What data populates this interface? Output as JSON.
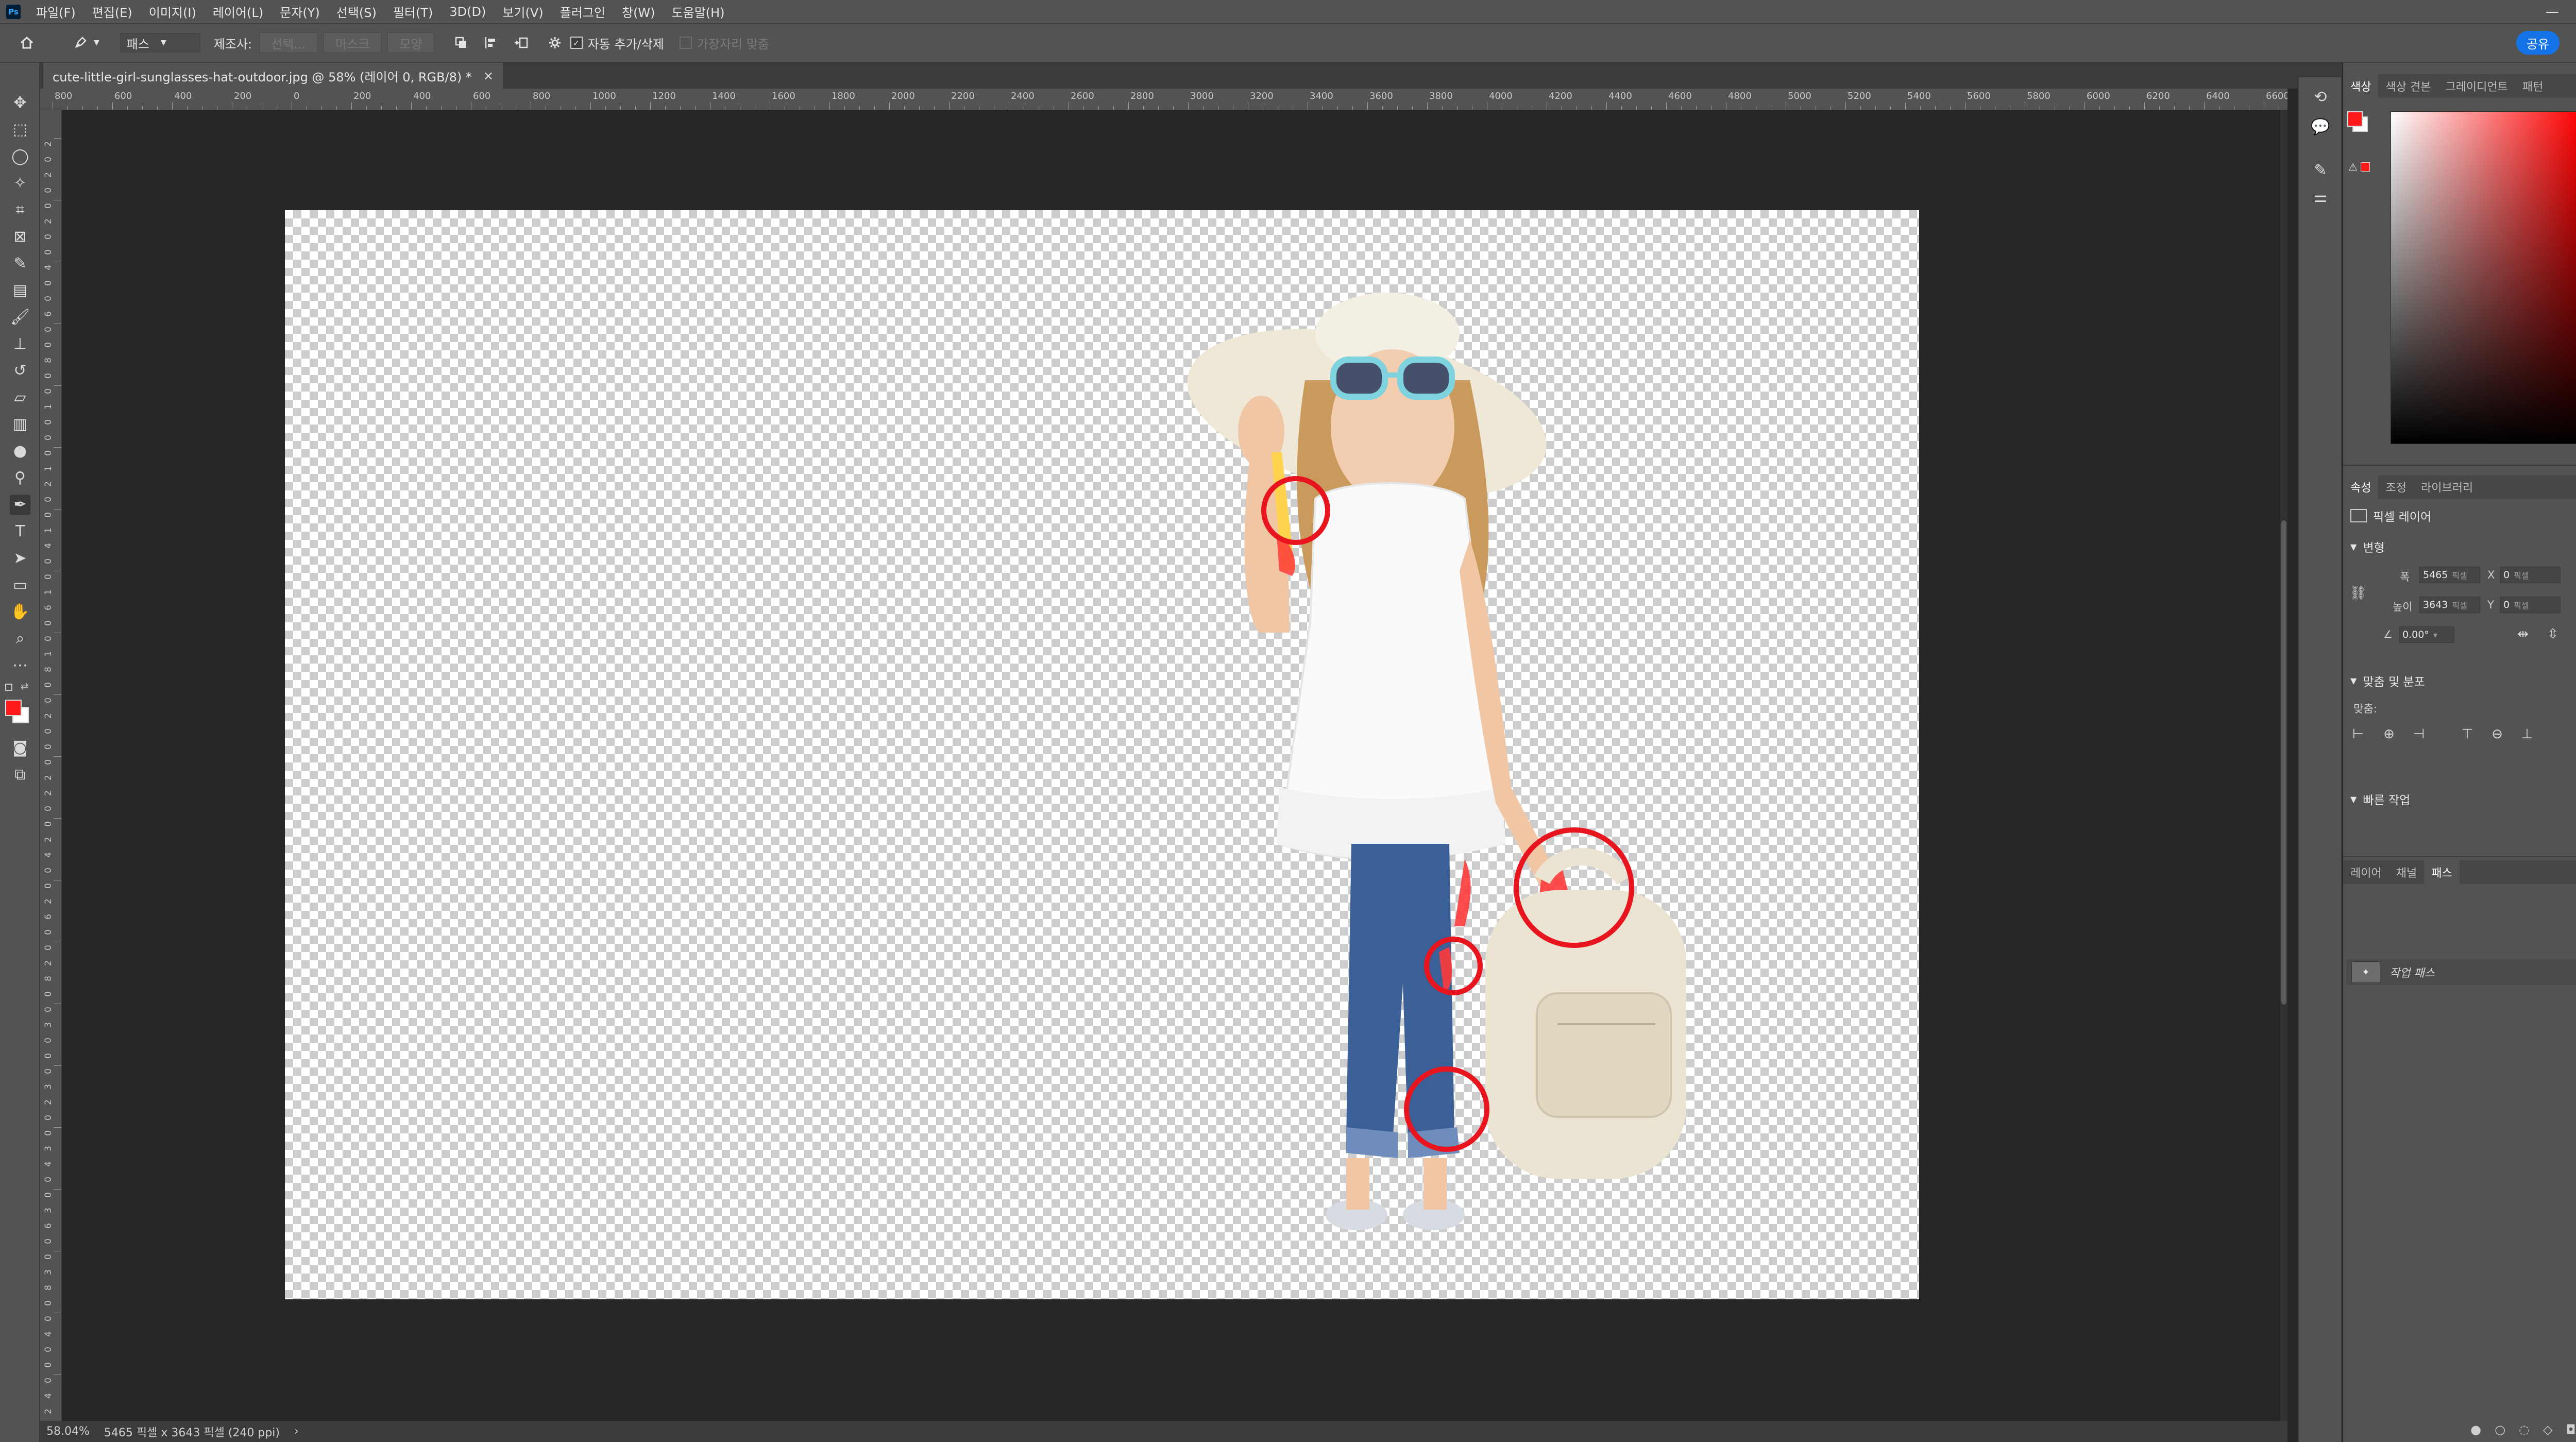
{
  "app": {
    "logo": "Ps",
    "menu": [
      "파일(F)",
      "편집(E)",
      "이미지(I)",
      "레이어(L)",
      "문자(Y)",
      "선택(S)",
      "필터(T)",
      "3D(D)",
      "보기(V)",
      "플러그인",
      "창(W)",
      "도움말(H)"
    ],
    "window_controls": [
      "—",
      "❐",
      "✕"
    ]
  },
  "options": {
    "mode": "패스",
    "make_label": "제조사:",
    "make_buttons": [
      "선택...",
      "마스크",
      "모양"
    ],
    "auto_add_delete_label": "자동 추가/삭제",
    "auto_add_delete_checked": true,
    "align_edges_label": "가장자리 맞춤",
    "align_edges_checked": false,
    "share_label": "공유"
  },
  "document": {
    "tab_title": "cute-little-girl-sunglasses-hat-outdoor.jpg @ 58% (레이어 0, RGB/8) *",
    "tab_close": "×",
    "ruler_top": [
      "800",
      "600",
      "400",
      "200",
      "0",
      "200",
      "400",
      "600",
      "800",
      "1000",
      "1200",
      "1400",
      "1600",
      "1800",
      "2000",
      "2200",
      "2400",
      "2600",
      "2800",
      "3000",
      "3200",
      "3400",
      "3600",
      "3800",
      "4000",
      "4200",
      "4400",
      "4600",
      "4800",
      "5000",
      "5200",
      "5400",
      "5600",
      "5800",
      "6000",
      "6200",
      "6400",
      "6600"
    ],
    "ruler_left": [
      "2",
      "0",
      "2",
      "0",
      "0",
      "2",
      "0",
      "0",
      "4",
      "0",
      "0",
      "6",
      "0",
      "0",
      "8",
      "0",
      "0",
      "1",
      "0",
      "0",
      "0",
      "1",
      "2",
      "0",
      "0",
      "1",
      "4",
      "0",
      "0",
      "1",
      "6",
      "0",
      "0",
      "1",
      "8",
      "0",
      "0",
      "2",
      "0",
      "0",
      "0",
      "2",
      "2",
      "0",
      "0",
      "2",
      "4",
      "0",
      "0",
      "2",
      "6",
      "0",
      "0",
      "2",
      "8",
      "0",
      "0",
      "3",
      "0",
      "0",
      "0",
      "3",
      "2",
      "0",
      "0",
      "3",
      "4",
      "0",
      "0",
      "3",
      "6",
      "0",
      "0",
      "3",
      "8",
      "0",
      "0",
      "4",
      "0",
      "0",
      "0",
      "4",
      "2",
      "0",
      "0"
    ]
  },
  "status": {
    "zoom": "58.04%",
    "doc_info": "5465 픽셀 x 3643 픽셀 (240 ppi)",
    "arrow": "›"
  },
  "color_panel": {
    "tabs": [
      "색상",
      "색상 견본",
      "그레이디언트",
      "패턴"
    ],
    "active_tab": "색상",
    "foreground": "#ff1a1a",
    "background": "#ffffff"
  },
  "properties_panel": {
    "tabs": [
      "속성",
      "조정",
      "라이브러리"
    ],
    "active_tab": "속성",
    "layer_type": "픽셀 레이어",
    "transform_title": "변형",
    "width_label": "폭",
    "width_value": "5465",
    "height_label": "높이",
    "height_value": "3643",
    "unit": "픽셀",
    "x_label": "X",
    "x_value": "0",
    "y_label": "Y",
    "y_value": "0",
    "angle_value": "0.00°",
    "align_title": "맞춤 및 분포",
    "align_label": "맞춤:",
    "more": "•••",
    "quick_actions_title": "빠른 작업"
  },
  "paths_panel": {
    "tabs": [
      "레이어",
      "채널",
      "패스"
    ],
    "active_tab": "패스",
    "work_path": "작업 패스"
  },
  "colors": {
    "annotation_red": "#e8141e",
    "path_fill": "#ff3b3b"
  }
}
